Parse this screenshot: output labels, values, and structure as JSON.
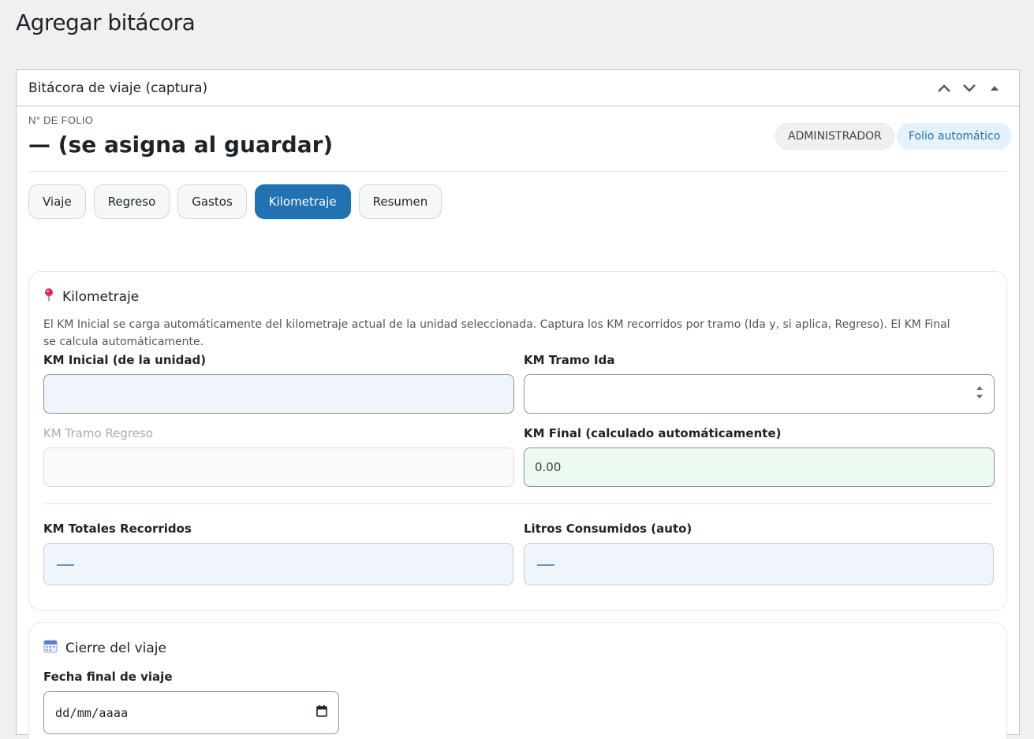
{
  "page": {
    "title": "Agregar bitácora"
  },
  "postbox": {
    "title": "Bitácora de viaje (captura)"
  },
  "folio": {
    "label": "N° DE FOLIO",
    "value": "— (se asigna al guardar)",
    "badge_role": "ADMINISTRADOR",
    "badge_folio": "Folio automático"
  },
  "tabs": [
    {
      "label": "Viaje",
      "active": false
    },
    {
      "label": "Regreso",
      "active": false
    },
    {
      "label": "Gastos",
      "active": false
    },
    {
      "label": "Kilometraje",
      "active": true
    },
    {
      "label": "Resumen",
      "active": false
    }
  ],
  "kilometraje": {
    "title": "Kilometraje",
    "icon": "pushpin-icon",
    "description": "El KM Inicial se carga automáticamente del kilometraje actual de la unidad seleccionada. Captura los KM recorridos por tramo (Ida y, si aplica, Regreso). El KM Final se calcula automáticamente.",
    "km_inicial": {
      "label": "KM Inicial (de la unidad)",
      "value": ""
    },
    "km_tramo_ida": {
      "label": "KM Tramo Ida",
      "value": ""
    },
    "km_tramo_regreso": {
      "label": "KM Tramo Regreso",
      "value": ""
    },
    "km_final": {
      "label": "KM Final (calculado automáticamente)",
      "value": "0.00"
    },
    "km_totales": {
      "label": "KM Totales Recorridos",
      "value": "—"
    },
    "litros": {
      "label": "Litros Consumidos (auto)",
      "value": "—"
    }
  },
  "cierre": {
    "title": "Cierre del viaje",
    "icon": "calendar-icon",
    "fecha_label": "Fecha final de viaje",
    "fecha_placeholder": "dd/mm/aaaa"
  },
  "colors": {
    "accent": "#2271b1",
    "readonly_bg": "#f0f4fb",
    "calc_bg": "#edfaef"
  }
}
